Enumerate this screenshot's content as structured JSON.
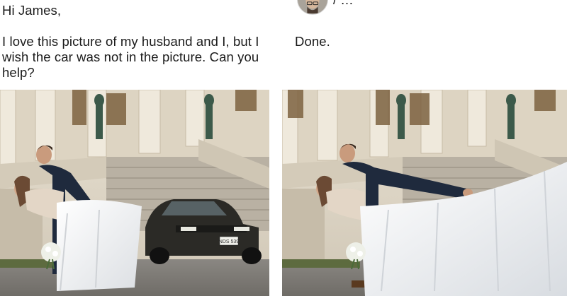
{
  "message": {
    "greeting": "Hi James,",
    "request": "I love this picture of my husband and I, but I wish the car was not in the picture. Can you help?"
  },
  "response": {
    "reply": "Done.",
    "clipped_caption": "/ …"
  },
  "photos": {
    "original": {
      "description_icon": "wedding-photo-with-car"
    },
    "edited": {
      "description_icon": "wedding-photo-car-covered-by-dress"
    }
  },
  "car": {
    "plate": "NDS 539"
  }
}
